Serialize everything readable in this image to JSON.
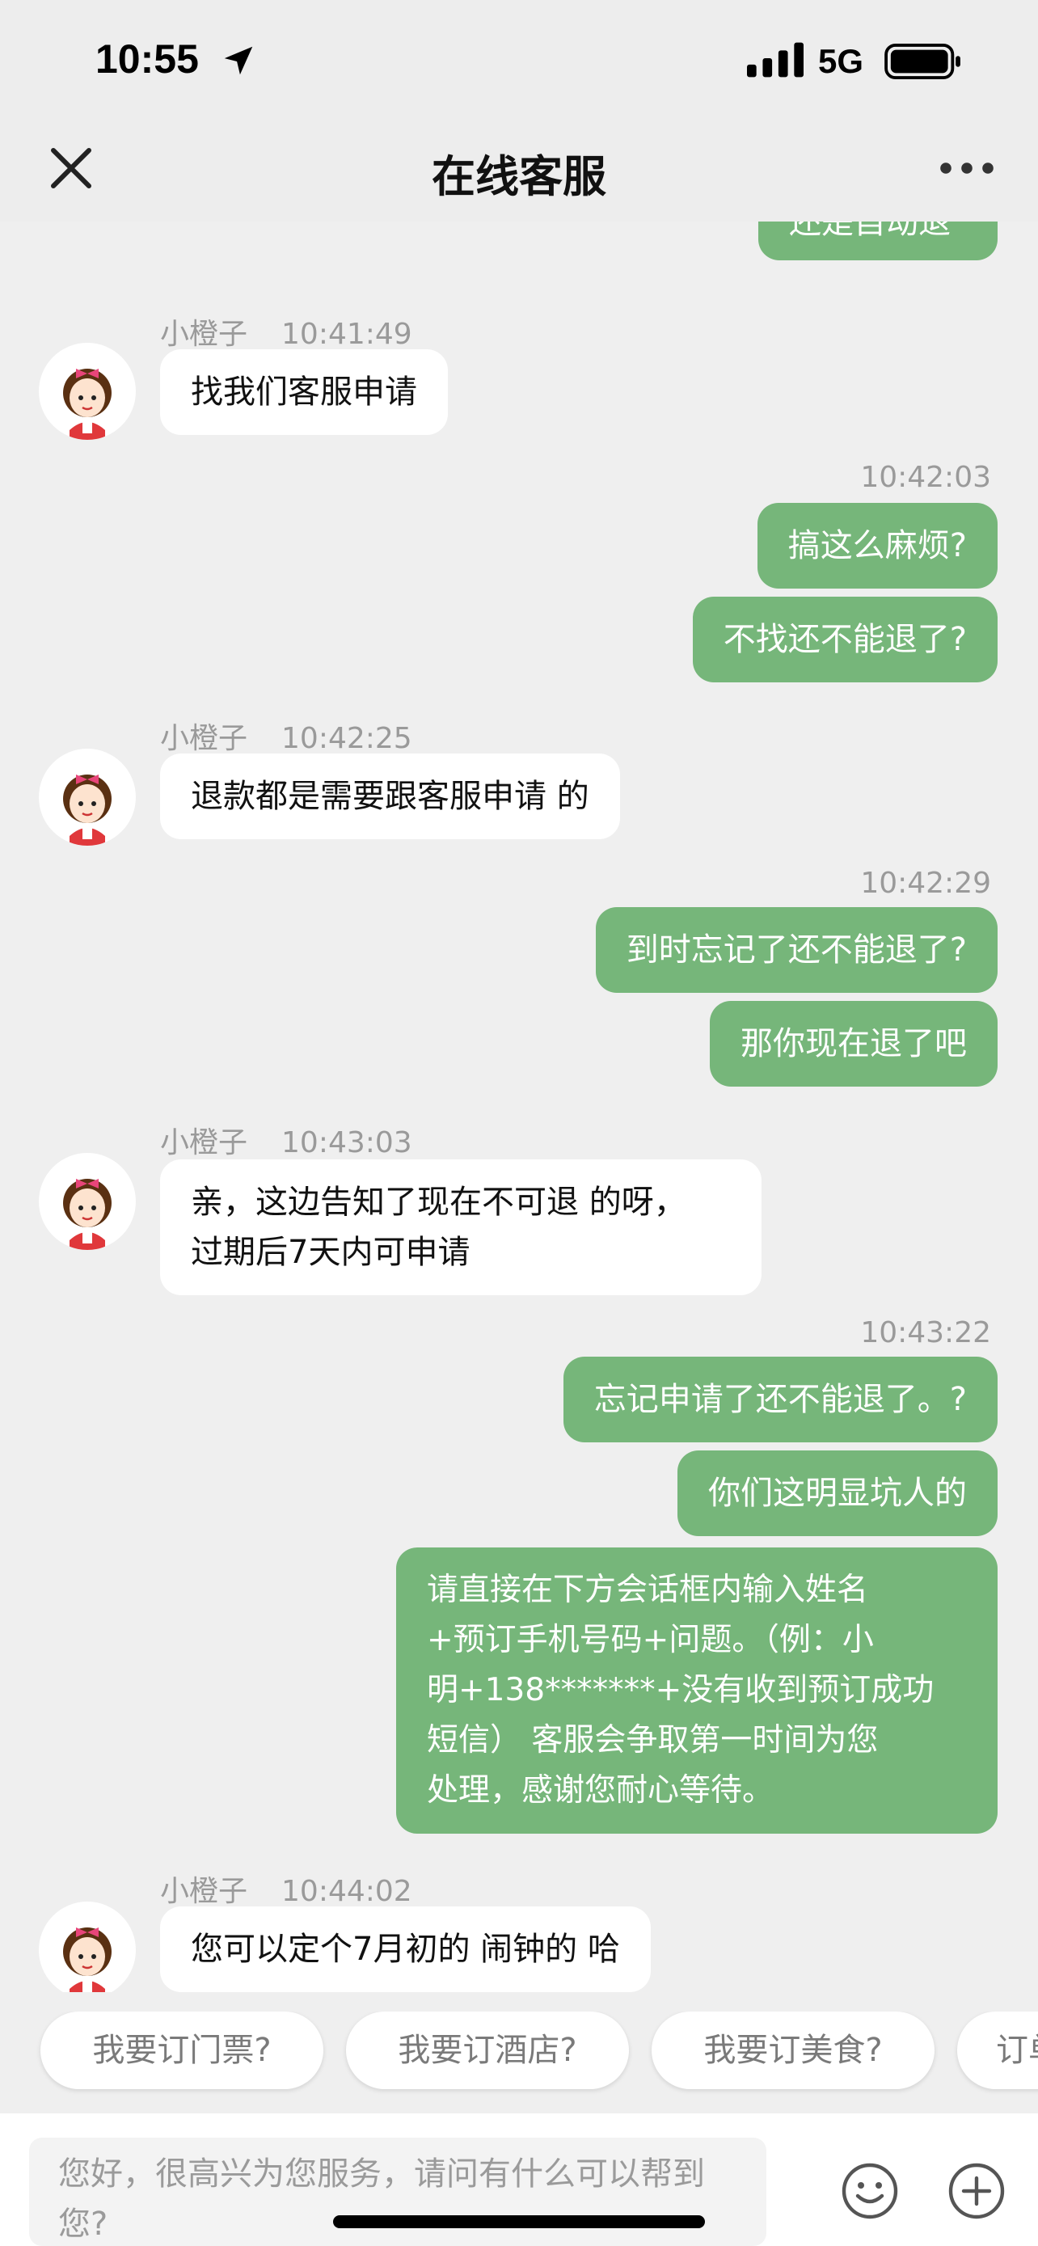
{
  "status_bar": {
    "time": "10:55",
    "network": "5G"
  },
  "nav": {
    "title": "在线客服"
  },
  "agent_name": "小橙子",
  "messages": {
    "m0": "还是自动退",
    "b1_time": "10:41:49",
    "b1": "找我们客服申请",
    "t2": "10:42:03",
    "m2a": "搞这么麻烦?",
    "m2b": "不找还不能退了?",
    "b3_time": "10:42:25",
    "b3": "退款都是需要跟客服申请 的",
    "t4": "10:42:29",
    "m4a": "到时忘记了还不能退了?",
    "m4b": "那你现在退了吧",
    "b5_time": "10:43:03",
    "b5": "亲，这边告知了现在不可退 的呀，\n过期后7天内可申请",
    "t6": "10:43:22",
    "m6a": "忘记申请了还不能退了。?",
    "m6b": "你们这明显坑人的",
    "m6c": "请直接在下方会话框内输入姓名\n+预订手机号码+问题。（例：小\n明+138*******+没有收到预订成功\n短信） 客服会争取第一时间为您\n处理，感谢您耐心等待。",
    "b7_time": "10:44:02",
    "b7": "您可以定个7月初的 闹钟的 哈"
  },
  "quick_replies": [
    "我要订门票?",
    "我要订酒店?",
    "我要订美食?",
    "订单"
  ],
  "input": {
    "placeholder": "您好，很高兴为您服务，请问有什么可以帮到您?"
  },
  "colors": {
    "me_bubble": "#76b67a",
    "background": "#efefef"
  }
}
